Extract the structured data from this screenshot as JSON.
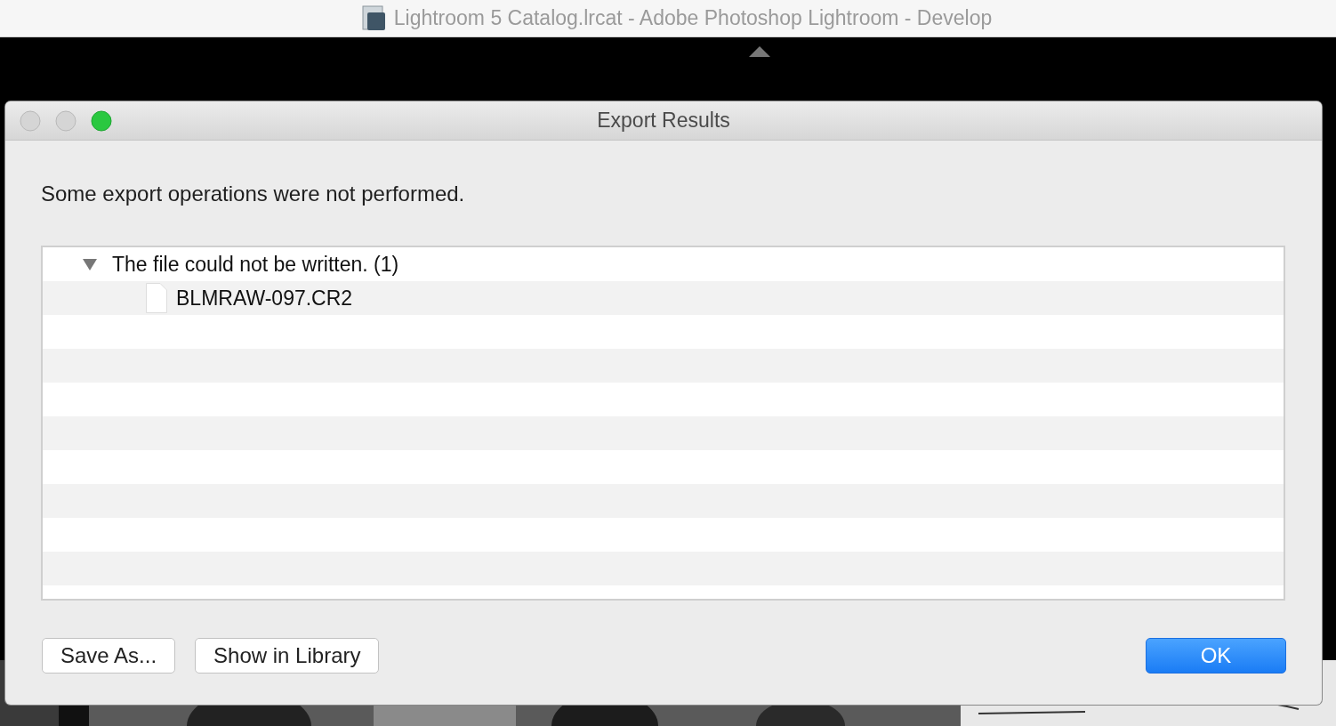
{
  "app_window": {
    "title": "Lightroom 5 Catalog.lrcat - Adobe Photoshop Lightroom - Develop"
  },
  "dialog": {
    "title": "Export Results",
    "message": "Some export operations were not performed.",
    "results": [
      {
        "label": "The file could not be written. (1)",
        "expanded": true,
        "children": [
          {
            "label": "BLMRAW-097.CR2"
          }
        ]
      }
    ],
    "buttons": [
      {
        "label": "Save As...",
        "kind": "default"
      },
      {
        "label": "Show in Library",
        "kind": "default"
      },
      {
        "label": "OK",
        "kind": "primary"
      }
    ]
  }
}
